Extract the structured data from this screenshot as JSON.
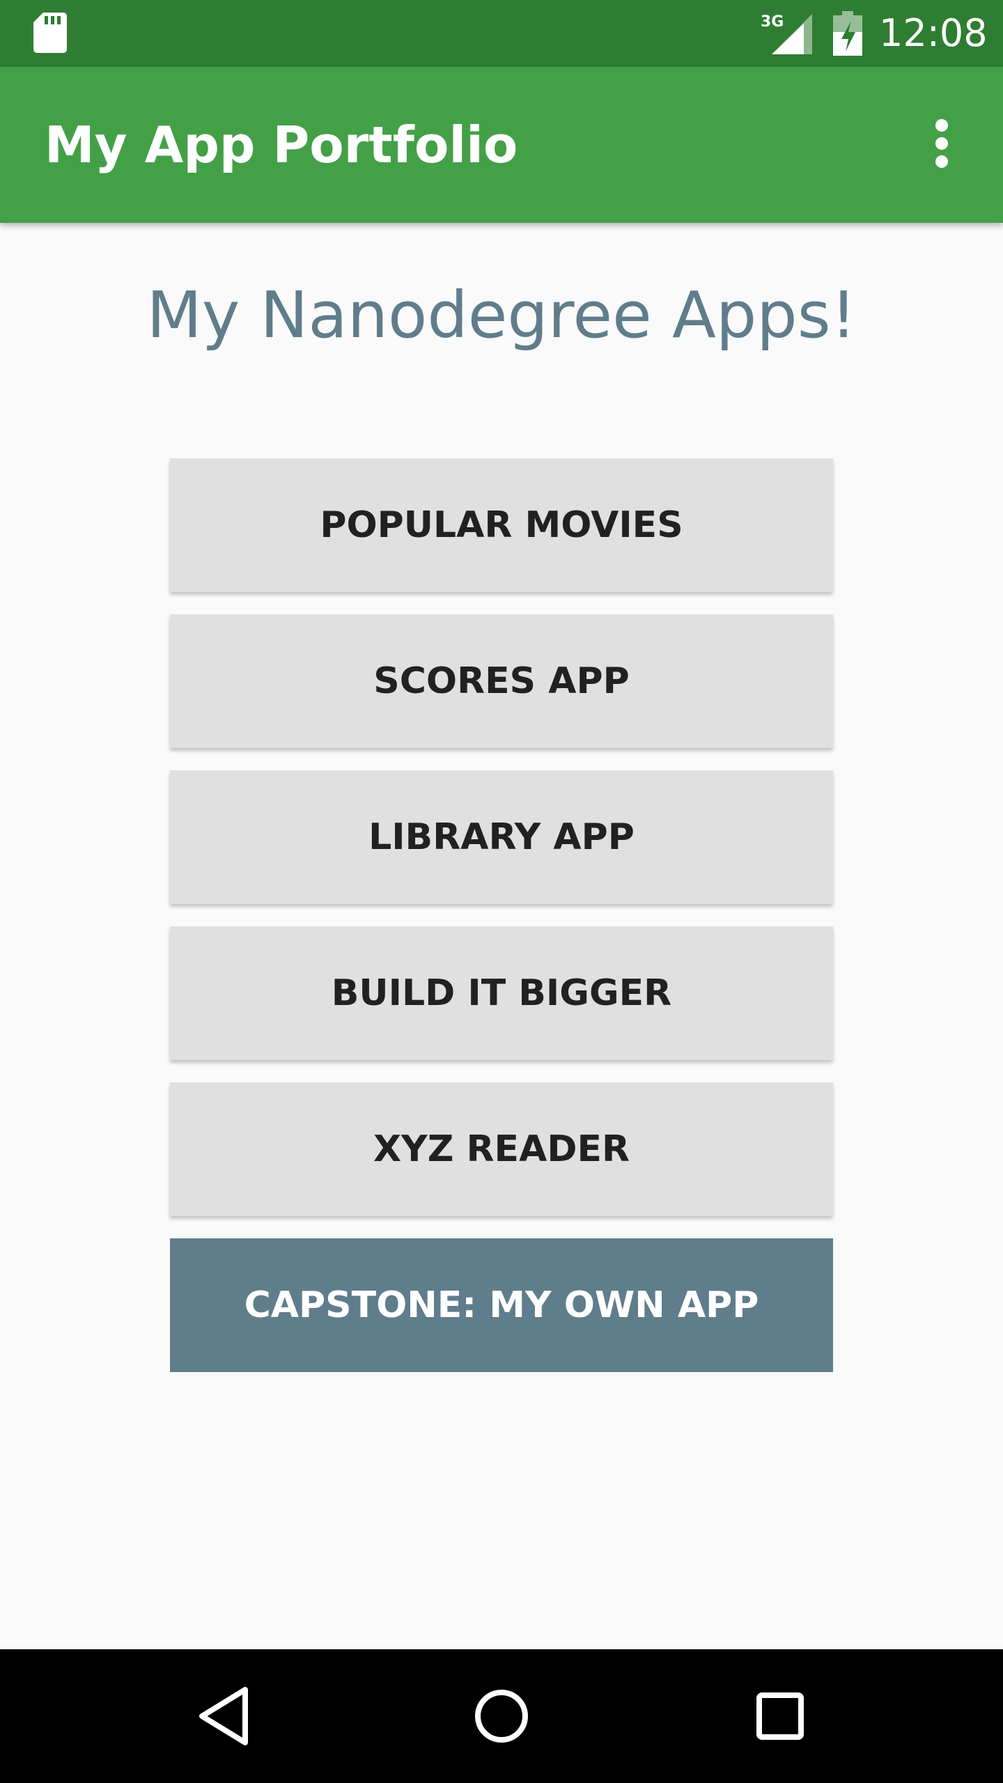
{
  "status_bar": {
    "time": "12:08",
    "network": "3G",
    "icons": [
      "sd-card-icon",
      "signal-3g-icon",
      "battery-charging-icon"
    ],
    "color": "#2e7d32"
  },
  "app_bar": {
    "title": "My App Portfolio",
    "overflow_icon": "more-vert-icon",
    "color": "#43a047"
  },
  "main": {
    "heading": "My Nanodegree Apps!",
    "heading_color": "#607d8b",
    "buttons": [
      {
        "label": "POPULAR MOVIES"
      },
      {
        "label": "SCORES APP"
      },
      {
        "label": "LIBRARY APP"
      },
      {
        "label": "BUILD IT BIGGER"
      },
      {
        "label": "XYZ READER"
      },
      {
        "label": "CAPSTONE: MY OWN APP",
        "color": "#607d8b"
      }
    ]
  },
  "nav_bar": {
    "icons": [
      "back-icon",
      "home-icon",
      "recents-icon"
    ]
  }
}
